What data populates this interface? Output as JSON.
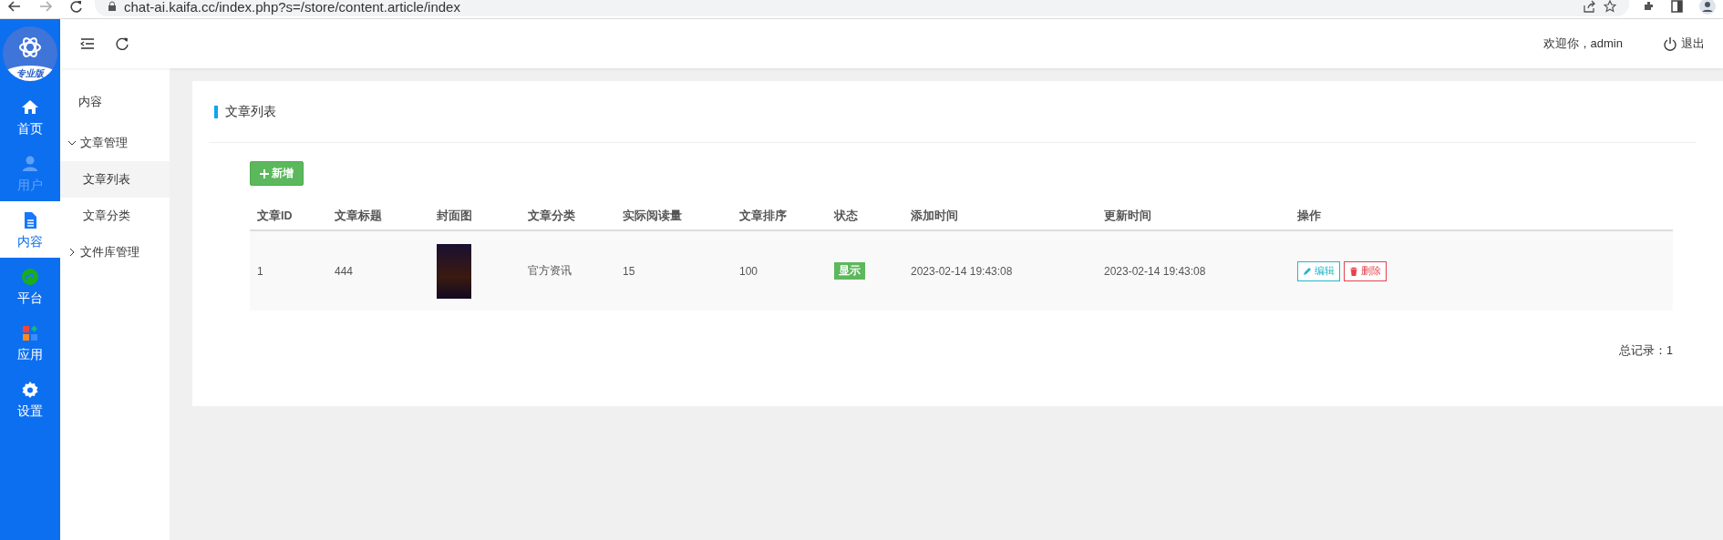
{
  "browser": {
    "url": "chat-ai.kaifa.cc/index.php?s=/store/content.article/index"
  },
  "sidebar": {
    "badge": "专业版",
    "items": [
      {
        "label": "首页",
        "selected": false,
        "disabled": false
      },
      {
        "label": "用户",
        "selected": false,
        "disabled": true
      },
      {
        "label": "内容",
        "selected": true,
        "disabled": false
      },
      {
        "label": "平台",
        "selected": false,
        "disabled": false
      },
      {
        "label": "应用",
        "selected": false,
        "disabled": false
      },
      {
        "label": "设置",
        "selected": false,
        "disabled": false
      }
    ]
  },
  "subnav": {
    "title": "内容",
    "items": [
      {
        "label": "文章管理",
        "expanded": true,
        "children": [
          {
            "label": "文章列表",
            "selected": true
          },
          {
            "label": "文章分类",
            "selected": false
          }
        ]
      },
      {
        "label": "文件库管理",
        "expanded": false
      }
    ]
  },
  "header": {
    "welcome": "欢迎你，admin",
    "logout": "退出"
  },
  "page": {
    "title": "文章列表",
    "add_button": "新增",
    "table": {
      "columns": [
        "文章ID",
        "文章标题",
        "封面图",
        "文章分类",
        "实际阅读量",
        "文章排序",
        "状态",
        "添加时间",
        "更新时间",
        "操作"
      ],
      "rows": [
        {
          "id": "1",
          "title": "444",
          "category": "官方资讯",
          "reads": "15",
          "sort": "100",
          "status": {
            "label": "显示",
            "on": true
          },
          "added": "2023-02-14 19:43:08",
          "updated": "2023-02-14 19:43:08",
          "actions": [
            {
              "kind": "edit",
              "label": "编辑"
            },
            {
              "kind": "delete",
              "label": "删除"
            }
          ]
        }
      ]
    },
    "total": "总记录：1"
  }
}
